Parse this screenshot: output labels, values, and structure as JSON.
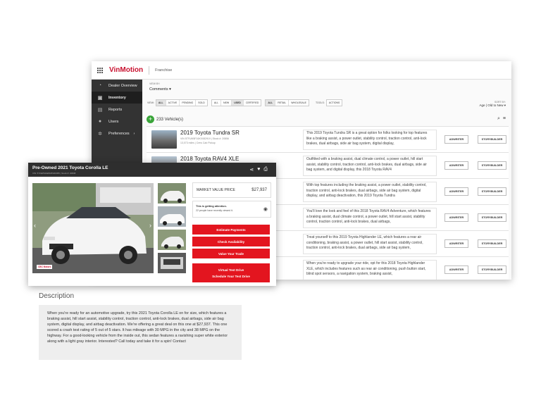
{
  "dashboard": {
    "brand": "VinMotion",
    "section": "Franchise",
    "sidebar": [
      {
        "label": "Dealer Overview",
        "icon": "speedometer-icon"
      },
      {
        "label": "Inventory",
        "icon": "car-icon"
      },
      {
        "label": "Reports",
        "icon": "report-icon"
      },
      {
        "label": "Users",
        "icon": "users-icon"
      },
      {
        "label": "Preferences",
        "icon": "gear-icon"
      }
    ],
    "view_by_label": "VIEW BY:",
    "view_by_value": "Comments ▾",
    "view_label": "VIEW:",
    "status_filters": [
      "ALL",
      "ACTIVE",
      "PENDING",
      "SOLD"
    ],
    "condition_filters": [
      "ALL",
      "NEW",
      "USED",
      "CERTIFIED"
    ],
    "channel_filters": [
      "ALL",
      "RETAIL",
      "WHOLESALE"
    ],
    "tools_label": "TOOLS:",
    "tools_button": "ACTIONS",
    "sort_label": "SORT BY:",
    "sort_value": "Age | Old to New ▾",
    "vehicle_count": "233 Vehicle(s)",
    "row_buttons": {
      "adwriter": "ADWRITER",
      "storybuilder": "STORYBUILDER"
    },
    "vehicles": [
      {
        "title": "2019 Toyota Tundra SR",
        "meta": "VIN 5TFUM5F16KX082919  |  Stock #: 20856",
        "meta2": "13,073 miles  |  Crew Cab Pickup",
        "description": "This 2019 Toyota Tundra SR is a great option for folks looking for top features like a braking assist, a power outlet, stability control, traction control, anti-lock brakes, dual airbags, side air bag system, digital display,"
      },
      {
        "title": "2018 Toyota RAV4 XLE",
        "meta": "VIN 2T3WFREV5JW409225  |  Stock #: 20841",
        "meta2": "",
        "description": "Outfitted with a braking assist, dual climate control, a power outlet, hill start assist, stability control, traction control, anti-lock brakes, dual airbags, side air bag system, and digital display, this 2018 Toyota RAV4"
      },
      {
        "title": "",
        "meta": "",
        "meta2": "",
        "description": "With top features including the braking assist, a power outlet, stability control, traction control, anti-lock brakes, dual airbags, side air bag system, digital display, and airbag deactivation, this 2019 Toyota Tundra"
      },
      {
        "title": "",
        "meta": "",
        "meta2": "",
        "description": "You'll love the look and feel of this 2018 Toyota RAV4 Adventure, which features a braking assist, dual climate control, a power outlet, hill start assist, stability control, traction control, anti-lock brakes, dual airbags,"
      },
      {
        "title": "",
        "meta": "",
        "meta2": "",
        "description": "Treat yourself to this 2019 Toyota Highlander LE, which features a rear air conditioning, braking assist, a power outlet, hill start assist, stability control, traction control, anti-lock brakes, dual airbags, side air bag system,"
      },
      {
        "title": "",
        "meta": "",
        "meta2": "",
        "description": "When you're ready to upgrade your ride, opt for this 2018 Toyota Highlander XLE, which includes features such as rear air conditioning, push button start, blind spot sensors, a navigation system, braking assist,"
      }
    ]
  },
  "detail": {
    "title": "Pre-Owned 2021 Toyota Corolla LE",
    "subtitle": "VIN: 5YFEPMAE5MP220455  |  Stock #: 20838",
    "logo_text": "CBC Motors",
    "market_label": "MARKET VALUE PRICE",
    "market_value": "$27,937",
    "attention_title": "This is getting attention.",
    "attention_sub": "22 people have recently viewed it.",
    "ctas": [
      "Estimate Payments",
      "Check Availability",
      "Value Your Trade"
    ],
    "combo_ctas": [
      "Virtual Test Drive",
      "Schedule Your Test Drive"
    ]
  },
  "description": {
    "heading": "Description",
    "text": "When you're ready for an automotive upgrade, try this 2021 Toyota Corolla LE on for size, which features a braking assist, hill start assist, stability control, traction control, anti-lock brakes, dual airbags, side air bag system, digital display, and airbag deactivation. We're offering a great deal on this one at $27,937. This one scored a crash test rating of 5 out of 5 stars. It has mileage with 30 MPG in the city and 38 MPG on the highway. For a good-looking vehicle from the inside out, this sedan features a ravishing super white exterior along with a light gray interior. Interested? Call today and take it for a spin! Contact"
  },
  "colors": {
    "brand_red": "#c8102e",
    "cta_red": "#e3151f",
    "sidebar": "#333333",
    "add_green": "#3aa53a"
  }
}
